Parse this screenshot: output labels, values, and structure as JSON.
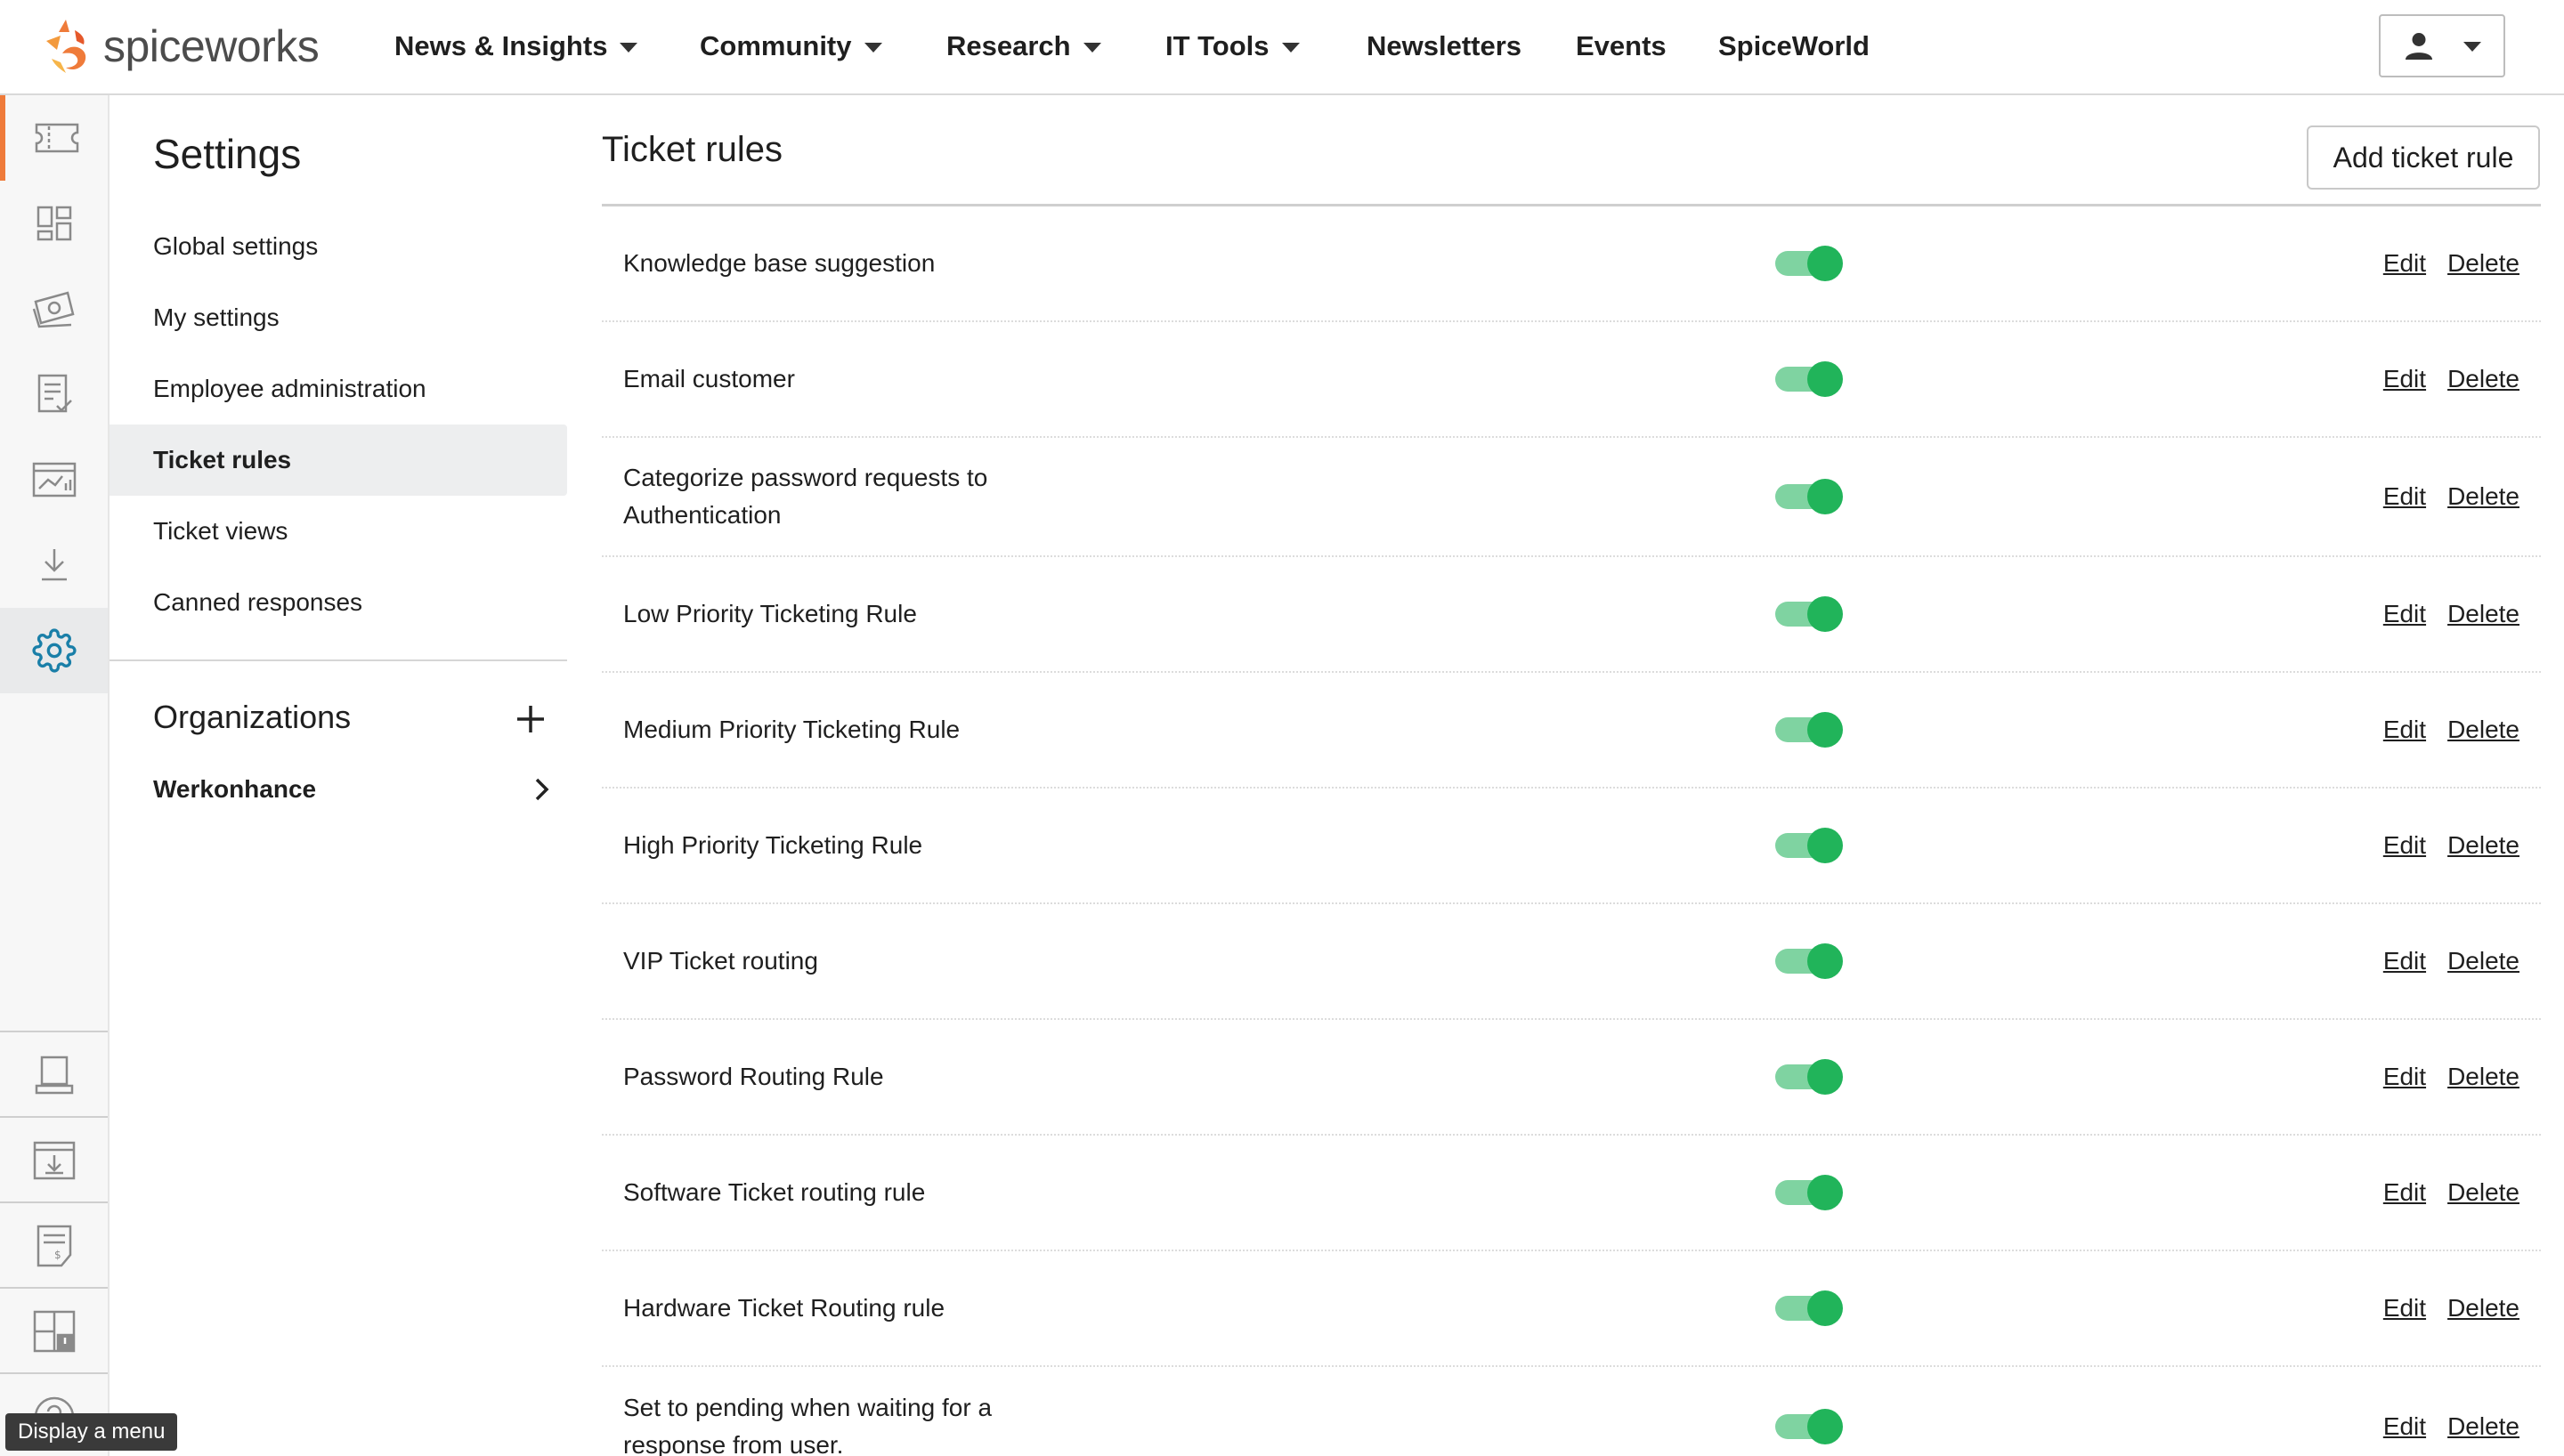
{
  "brand": {
    "name": "spiceworks",
    "accent": "#ef7b3a"
  },
  "nav": [
    {
      "label": "News & Insights",
      "dropdown": true
    },
    {
      "label": "Community",
      "dropdown": true
    },
    {
      "label": "Research",
      "dropdown": true
    },
    {
      "label": "IT Tools",
      "dropdown": true
    },
    {
      "label": "Newsletters",
      "dropdown": false
    },
    {
      "label": "Events",
      "dropdown": false
    },
    {
      "label": "SpiceWorld",
      "dropdown": false
    }
  ],
  "user_menu": {
    "icon": "person-icon",
    "caret": "chevron-down-icon"
  },
  "rail": {
    "top_icons": [
      "ticket-icon",
      "dashboard-icon",
      "inventory-icon",
      "reports-icon",
      "analytics-icon",
      "download-icon",
      "settings-icon"
    ],
    "bottom_icons": [
      "laptop-icon",
      "install-icon",
      "invoice-icon",
      "layout-alert-icon",
      "help-icon"
    ],
    "tooltip": "Display a menu"
  },
  "settings": {
    "title": "Settings",
    "items": [
      "Global settings",
      "My settings",
      "Employee administration",
      "Ticket rules",
      "Ticket views",
      "Canned responses"
    ],
    "active": "Ticket rules",
    "organizations_title": "Organizations",
    "organizations": [
      "Werkonhance"
    ]
  },
  "main": {
    "title": "Ticket rules",
    "add_button": "Add ticket rule",
    "edit_label": "Edit",
    "delete_label": "Delete",
    "toggle_on_color": "#21b45a",
    "rules": [
      {
        "name": "Knowledge base suggestion",
        "enabled": true
      },
      {
        "name": "Email customer",
        "enabled": true
      },
      {
        "name": "Categorize password requests to Authentication",
        "enabled": true
      },
      {
        "name": "Low Priority Ticketing Rule",
        "enabled": true
      },
      {
        "name": "Medium Priority Ticketing Rule",
        "enabled": true
      },
      {
        "name": "High Priority Ticketing Rule",
        "enabled": true
      },
      {
        "name": "VIP Ticket routing",
        "enabled": true
      },
      {
        "name": "Password Routing Rule",
        "enabled": true
      },
      {
        "name": "Software Ticket routing rule",
        "enabled": true
      },
      {
        "name": "Hardware Ticket Routing rule",
        "enabled": true
      },
      {
        "name": "Set to pending when waiting for a response from user.",
        "enabled": true
      }
    ]
  }
}
